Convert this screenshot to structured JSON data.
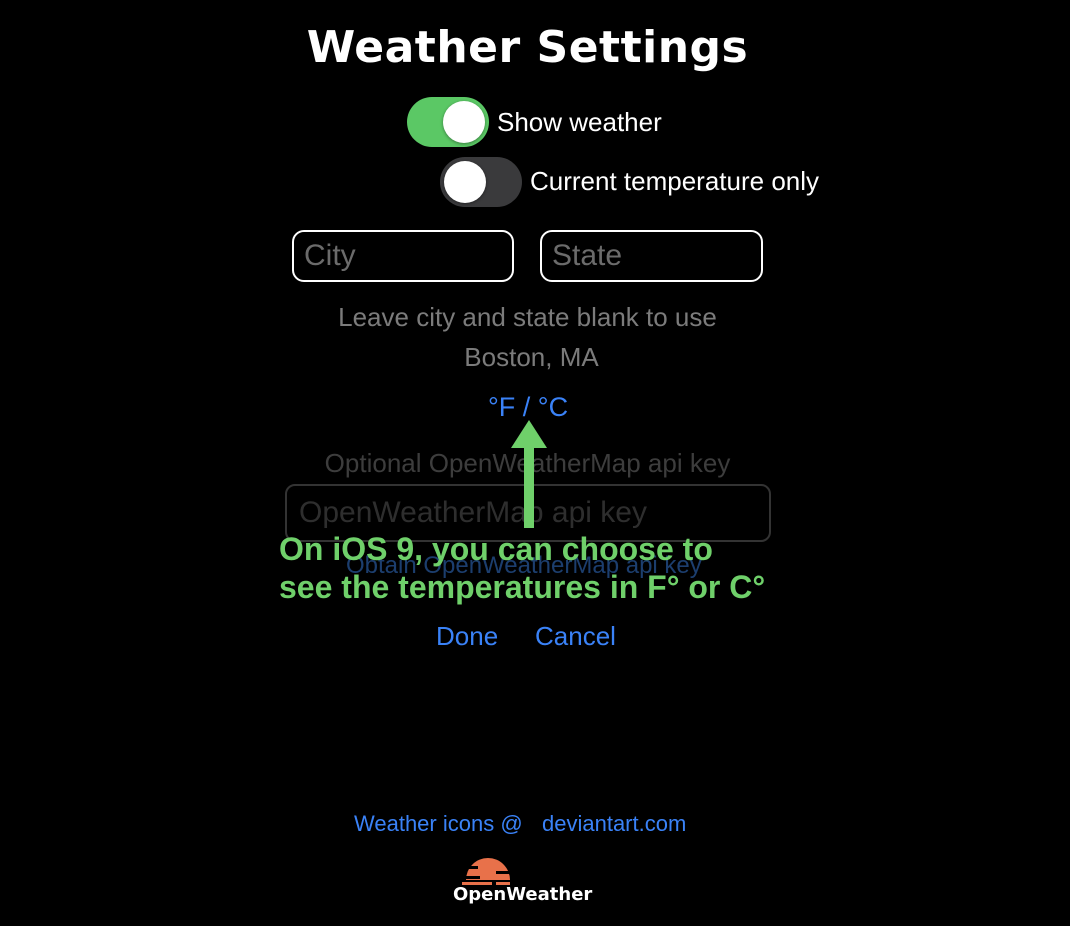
{
  "header": {
    "title": "Weather Settings"
  },
  "toggles": {
    "show_weather": {
      "label": "Show weather",
      "state": "on"
    },
    "current_temp_only": {
      "label": "Current temperature only",
      "state": "off"
    }
  },
  "location": {
    "city_placeholder": "City",
    "state_placeholder": "State",
    "hint_line1": "Leave city and state blank to use",
    "hint_line2": "Boston, MA"
  },
  "units": {
    "label": "°F / °C"
  },
  "api": {
    "label": "Optional OpenWeatherMap api key",
    "placeholder": "OpenWeatherMap api key",
    "obtain_link": "Obtain OpenWeatherMap api key"
  },
  "actions": {
    "done_label": "Done",
    "cancel_label": "Cancel"
  },
  "annotation": {
    "line1": "On iOS 9, you can choose to",
    "line2": "see the temperatures in F° or C°"
  },
  "footer": {
    "credits_prefix": "Weather icons @",
    "credits_link": "deviantart.com",
    "brand_name": "OpenWeather"
  },
  "colors": {
    "background": "#000000",
    "toggle_on": "#5bc865",
    "toggle_off": "#3a3a3c",
    "link_blue": "#3a82f7",
    "annotation_green": "#6fd06a",
    "brand_orange": "#e8714a"
  },
  "icons": {
    "brand": "openweather-sun-icon",
    "annotation_arrow": "up-arrow-icon"
  }
}
